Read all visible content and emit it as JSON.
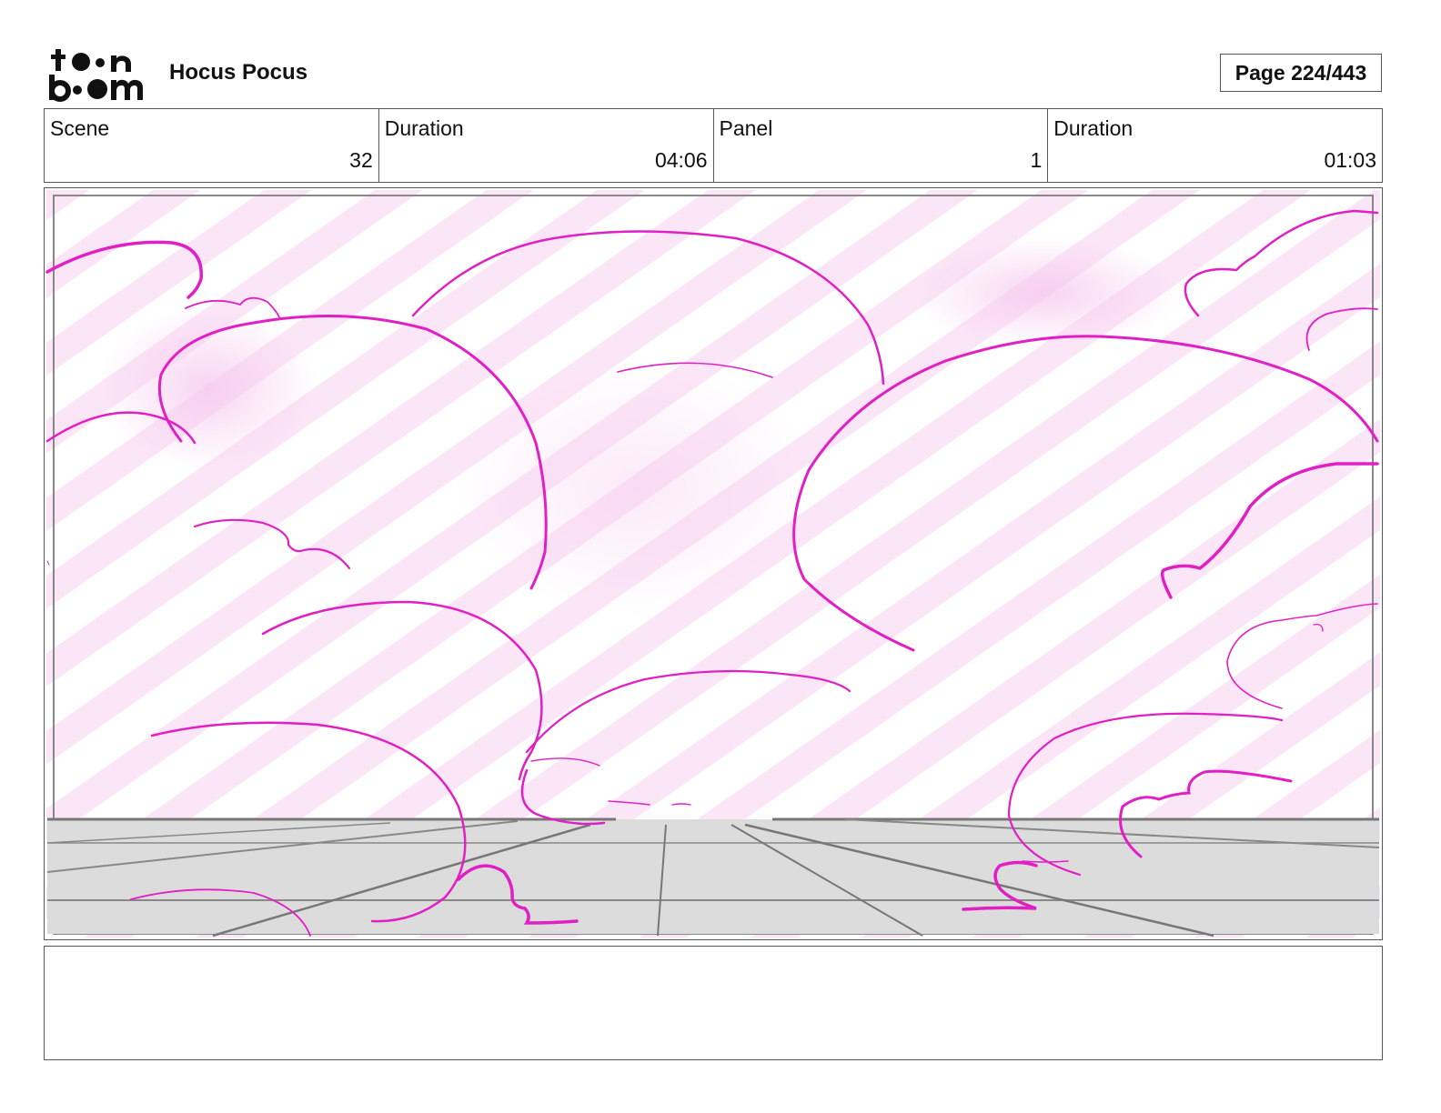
{
  "header": {
    "logo_text": "toonboom",
    "project_title": "Hocus Pocus",
    "page": "Page 224/443"
  },
  "info": {
    "scene_label": "Scene",
    "scene_value": "32",
    "scene_duration_label": "Duration",
    "scene_duration_value": "04:06",
    "panel_label": "Panel",
    "panel_value": "1",
    "panel_duration_label": "Duration",
    "panel_duration_value": "01:03"
  },
  "notes": {
    "text": ""
  },
  "colors": {
    "cloud_line": "#e01fc4",
    "cloud_tint": "#f7d6f0",
    "floor": "#dcdcdc",
    "floor_line": "#777777",
    "border": "#555555"
  }
}
